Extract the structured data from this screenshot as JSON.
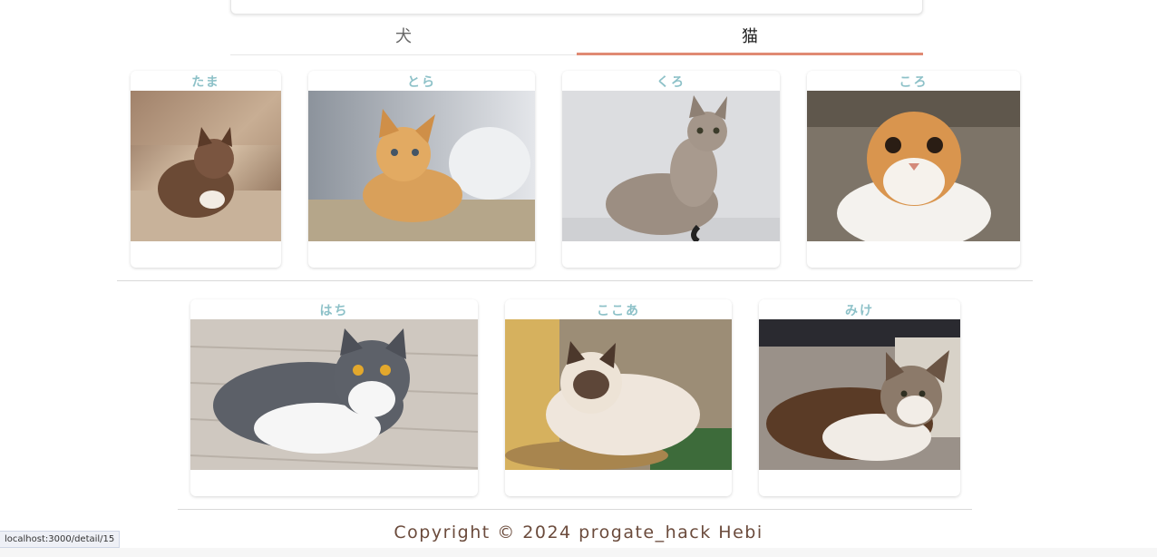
{
  "tabs": [
    {
      "label": "犬",
      "active": false
    },
    {
      "label": "猫",
      "active": true
    }
  ],
  "cats": [
    {
      "name": "たま"
    },
    {
      "name": "とら"
    },
    {
      "name": "くろ"
    },
    {
      "name": "ころ"
    },
    {
      "name": "はち"
    },
    {
      "name": "ここあ"
    },
    {
      "name": "みけ"
    }
  ],
  "footer": {
    "copyright": "Copyright © 2024 progate_hack Hebi"
  },
  "status_bar": {
    "url": "localhost:3000/detail/15"
  },
  "colors": {
    "accent_underline": "#e08a73",
    "name_color": "#8dc1c8",
    "footer_color": "#6b4b3c"
  }
}
